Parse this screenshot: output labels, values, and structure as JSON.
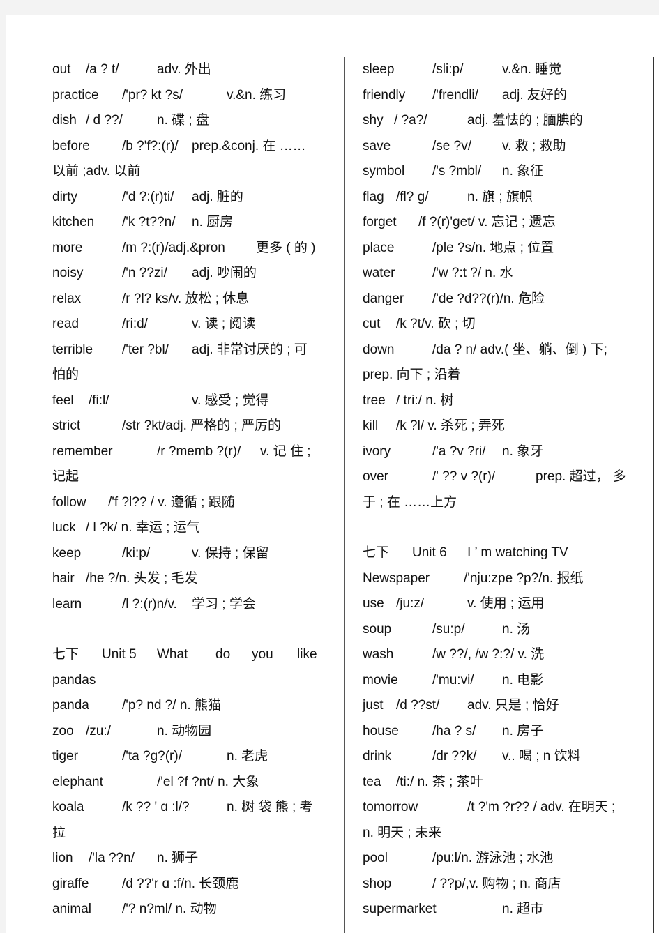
{
  "left_column": {
    "entries_a": [
      {
        "word": "out",
        "phon": "/a ? t/",
        "def": "adv. 外出"
      },
      {
        "word": "practice",
        "phon": "/'pr?   kt ?s/",
        "def": "v.&n. 练习"
      },
      {
        "word": "dish",
        "phon": "/ d ??/",
        "def": "n. 碟 ; 盘"
      },
      {
        "word": "before",
        "phon": "/b ?'f?:(r)/",
        "def": "prep.&conj.   在 ……",
        "cont": "以前 ;adv. 以前"
      },
      {
        "word": "dirty",
        "phon": "/'d ?:(r)ti/",
        "def": "adj. 脏的"
      },
      {
        "word": "kitchen",
        "phon": "/'k ?t??n/",
        "def": "n. 厨房"
      },
      {
        "word": "more",
        "phon": "/m ?:(r)/adj.&pron",
        "def": "更多 ( 的 )"
      },
      {
        "word": "noisy",
        "phon": "/'n ??zi/",
        "def": "adj. 吵闹的"
      },
      {
        "word": "relax",
        "phon": "/r ?l?  ks/v. 放松 ; 休息",
        "def": ""
      },
      {
        "word": "read",
        "phon": "/ri:d/",
        "def": "v. 读 ; 阅读"
      },
      {
        "word": "terrible",
        "phon": "/'ter  ?bl/",
        "def": "adj. 非常讨厌的   ; 可",
        "cont": "怕的"
      },
      {
        "word": "feel",
        "phon": "/fi:l/",
        "def": "v. 感受 ; 觉得"
      },
      {
        "word": "strict",
        "phon": "/str  ?kt/adj.  严格的  ; 严厉的",
        "def": ""
      },
      {
        "word": "remember",
        "phon": "/r ?memb  ?(r)/",
        "def": "v.  记  住  ;",
        "cont": "记起"
      },
      {
        "word": "follow",
        "phon": "/'f  ?l?? /  v. 遵循 ; 跟随",
        "def": ""
      },
      {
        "word": "luck",
        "phon": "/ l ?k/  n. 幸运 ; 运气",
        "def": ""
      },
      {
        "word": "keep",
        "phon": "/ki:p/",
        "def": "v. 保持 ; 保留"
      },
      {
        "word": "hair",
        "phon": "/he ?/n. 头发 ; 毛发",
        "def": ""
      },
      {
        "word": "learn",
        "phon": "/l ?:(r)n/v.",
        "def": "学习 ; 学会"
      }
    ],
    "unit5_heading": {
      "grade": "七下",
      "unit": "Unit  5",
      "title_words": [
        "What",
        "do",
        "you",
        "like"
      ],
      "title_cont": "pandas"
    },
    "entries_b": [
      {
        "word": "panda",
        "phon": "/'p?   nd ?/  n. 熊猫",
        "def": ""
      },
      {
        "word": "zoo",
        "phon": "/zu:/",
        "def": "n. 动物园"
      },
      {
        "word": "tiger",
        "phon": "/'ta  ?g?(r)/",
        "def": "n. 老虎"
      },
      {
        "word": "elephant",
        "phon": "/'el  ?f ?nt/  n.  大象",
        "def": ""
      },
      {
        "word": "koala",
        "phon": "/k ?? ' ɑ   :l/?",
        "def": "n. 树 袋 熊 ; 考",
        "cont": "拉"
      },
      {
        "word": "lion",
        "phon": "/'la ??n/",
        "def": "n. 狮子"
      },
      {
        "word": "giraffe",
        "phon": "/d ??'r ɑ   :f/n. 长颈鹿",
        "def": ""
      },
      {
        "word": "animal",
        "phon": "/'?   n?ml/  n.  动物",
        "def": ""
      }
    ]
  },
  "right_column": {
    "entries_a": [
      {
        "word": "sleep",
        "phon": "/sli:p/",
        "def": "v.&n.  睡觉"
      },
      {
        "word": "friendly",
        "phon": "/'frendli/",
        "def": "adj. 友好的"
      },
      {
        "word": "shy",
        "phon": "/ ?a?/",
        "def": "adj. 羞怯的  ; 腼腆的"
      },
      {
        "word": "save",
        "phon": "/se ?v/",
        "def": "v. 救 ; 救助"
      },
      {
        "word": "symbol",
        "phon": "/'s  ?mbl/",
        "def": "n. 象征"
      },
      {
        "word": "flag",
        "phon": "/fl?   g/",
        "def": "n. 旗 ; 旗帜"
      },
      {
        "word": "forget",
        "phon": "/f ?(r)'get/  v.   忘记 ; 遗忘",
        "def": ""
      },
      {
        "word": "place",
        "phon": "/ple ?s/n.  地点 ; 位置",
        "def": ""
      },
      {
        "word": "water",
        "phon": "/'w ?:t ?/  n. 水",
        "def": ""
      },
      {
        "word": "danger",
        "phon": "/'de ?d??(r)/n.  危险",
        "def": ""
      },
      {
        "word": "cut",
        "phon": "/k ?t/v.  砍 ; 切",
        "def": ""
      },
      {
        "word": "down",
        "phon": "/da ? n/  adv.(   坐、躺、倒   ) 下;",
        "def": "",
        "cont": "prep. 向下 ; 沿着"
      },
      {
        "word": "tree",
        "phon": "/ tri:/   n. 树",
        "def": ""
      },
      {
        "word": "kill",
        "phon": "/k ?l/  v. 杀死 ; 弄死",
        "def": ""
      },
      {
        "word": "ivory",
        "phon": "/'a ?v ?ri/",
        "def": "n. 象牙"
      },
      {
        "word": "over",
        "phon": "/' ?? v ?(r)/",
        "def": "prep.  超过，  多",
        "cont": "于 ; 在 ……上方"
      }
    ],
    "unit6_heading": {
      "grade": "七下",
      "unit": "Unit  6",
      "title": "I ’   m  watching  TV"
    },
    "entries_b": [
      {
        "word": "Newspaper",
        "phon": "/'nju:zpe   ?p?/n.  报纸",
        "def": ""
      },
      {
        "word": "use",
        "phon": "/ju:z/",
        "def": "v. 使用 ; 运用"
      },
      {
        "word": "soup",
        "phon": "/su:p/",
        "def": "n. 汤"
      },
      {
        "word": "wash",
        "phon": "/w ??/,  /w  ?:?/  v. 洗",
        "def": ""
      },
      {
        "word": "movie",
        "phon": "/'mu:vi/",
        "def": "n. 电影"
      },
      {
        "word": "just",
        "phon": "/d ??st/",
        "def": "adv. 只是 ; 恰好"
      },
      {
        "word": "house",
        "phon": "/ha ? s/",
        "def": "n. 房子"
      },
      {
        "word": "drink",
        "phon": "/dr ??k/",
        "def": "v.. 喝 ;  n  饮料"
      },
      {
        "word": "tea",
        "phon": "/ti:/  n.    茶 ; 茶叶",
        "def": ""
      },
      {
        "word": "tomorrow",
        "phon": "/t ?'m ?r?? /  adv.  在明天  ;",
        "def": "",
        "cont": "n. 明天 ; 未来"
      },
      {
        "word": "pool",
        "phon": "/pu:l/n.   游泳池 ; 水池",
        "def": ""
      },
      {
        "word": "shop",
        "phon": "/ ??p/,v.  购物 ;  n.  商店",
        "def": ""
      },
      {
        "word": "supermarket",
        "phon": "",
        "def": "n. 超市"
      }
    ]
  }
}
